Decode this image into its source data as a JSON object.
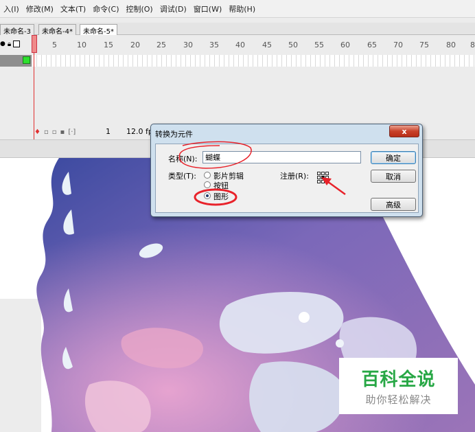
{
  "menu": {
    "items": [
      "入(I)",
      "修改(M)",
      "文本(T)",
      "命令(C)",
      "控制(O)",
      "调试(D)",
      "窗口(W)",
      "帮助(H)"
    ]
  },
  "tabs": [
    {
      "label": "未命名-3"
    },
    {
      "label": "未命名-4*"
    },
    {
      "label": "未命名-5*"
    }
  ],
  "timeline": {
    "frame_numbers": [
      "1",
      "5",
      "10",
      "15",
      "20",
      "25",
      "30",
      "35",
      "40",
      "45",
      "50",
      "55",
      "60",
      "65",
      "70",
      "75",
      "80",
      "8"
    ],
    "current_frame": "1",
    "fps": "12.0 fp"
  },
  "dialog": {
    "title": "转换为元件",
    "close_label": "x",
    "name_label": "名称(N):",
    "name_value": "蝴蝶",
    "type_label": "类型(T):",
    "type_options": [
      "影片剪辑",
      "按钮",
      "图形"
    ],
    "selected_type": "图形",
    "registration_label": "注册(R):",
    "ok_label": "确定",
    "cancel_label": "取消",
    "advanced_label": "高级"
  },
  "watermark": {
    "title": "百科全说",
    "subtitle": "助你轻松解决"
  },
  "colors": {
    "annotation": "#e8222a",
    "layer_color": "#2ee02e",
    "watermark_green": "#27a745",
    "dialog_frame": "#cfe0ee"
  }
}
